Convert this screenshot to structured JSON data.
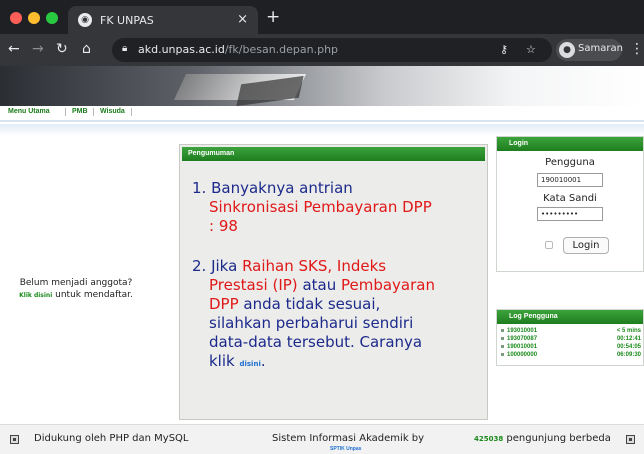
{
  "browser": {
    "tab_title": "FK UNPAS",
    "tab_close": "×",
    "new_tab": "+",
    "url_host": "akd.unpas.ac.id",
    "url_path": "/fk/besan.depan.php",
    "profile_name": "Samaran"
  },
  "navbar": {
    "items": [
      "Menu Utama",
      "PMB",
      "Wisuda"
    ]
  },
  "announcement": {
    "header": "Pengumuman",
    "item1": {
      "number": "1.",
      "line1": "Banyaknya antrian",
      "highlight": "Sinkronisasi Pembayaran DPP",
      "value": ": 98"
    },
    "item2": {
      "number": "2.",
      "lead": "Jika ",
      "highlight_a": "Raihan SKS, Indeks",
      "highlight_b": "Prestasi (IP)",
      "mid": " atau ",
      "highlight_c": "Pembayaran",
      "highlight_d": "DPP",
      "tail1": " anda tidak sesuai,",
      "tail2": "silahkan perbaharui sendiri",
      "tail3": "data-data tersebut. Caranya",
      "tail4": "klik ",
      "link": "disini",
      "end": "."
    }
  },
  "login": {
    "header": "Login",
    "username_label": "Pengguna",
    "username_value": "190010001",
    "password_label": "Kata Sandi",
    "password_value": "•••••••••",
    "button": "Login",
    "register_line1": "Belum menjadi anggota?",
    "register_link": "Klik disini",
    "register_tail": " untuk mendaftar."
  },
  "log": {
    "header": "Log Pengguna",
    "rows": [
      {
        "id": "193010001",
        "time": "< 5 mins"
      },
      {
        "id": "193070087",
        "time": "00:12:41"
      },
      {
        "id": "190010001",
        "time": "00:54:05"
      },
      {
        "id": "100000000",
        "time": "06:09:30"
      }
    ]
  },
  "footer": {
    "left": "Didukung oleh PHP dan MySQL",
    "center": "Sistem Informasi Akademik by",
    "center_sub": "SPTIK Unpas",
    "count": "425038",
    "right": " pengunjung berbeda"
  }
}
